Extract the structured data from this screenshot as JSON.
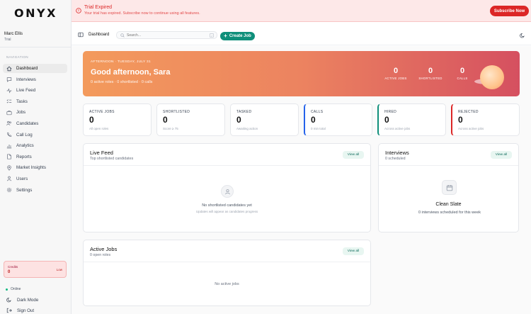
{
  "app": {
    "logo": "ONYX"
  },
  "user": {
    "name": "Marc Ellis",
    "plan": "Trial"
  },
  "sidebar": {
    "heading": "NAVIGATION",
    "items": [
      {
        "label": "Dashboard",
        "icon": "home-icon",
        "active": true
      },
      {
        "label": "Interviews",
        "icon": "chat-icon"
      },
      {
        "label": "Live Feed",
        "icon": "activity-icon"
      },
      {
        "label": "Tasks",
        "icon": "checklist-icon"
      },
      {
        "label": "Jobs",
        "icon": "briefcase-icon"
      },
      {
        "label": "Candidates",
        "icon": "users-icon"
      },
      {
        "label": "Call Log",
        "icon": "phone-icon"
      },
      {
        "label": "Analytics",
        "icon": "chart-icon"
      },
      {
        "label": "Reports",
        "icon": "file-icon"
      },
      {
        "label": "Market Insights",
        "icon": "pin-icon"
      },
      {
        "label": "Users",
        "icon": "user-group-icon"
      },
      {
        "label": "Settings",
        "icon": "gear-icon"
      }
    ],
    "credits": {
      "label": "Credits",
      "value": "0",
      "status": "Low"
    },
    "online": "Online",
    "dark_mode": "Dark Mode",
    "sign_out": "Sign Out"
  },
  "banner": {
    "title": "Trial Expired",
    "message": "Your trial has expired. Subscribe now to continue using all features.",
    "button": "Subscribe Now"
  },
  "topbar": {
    "breadcrumb": "Dashboard",
    "search_placeholder": "Search...",
    "search_shortcut": "/",
    "create_button": "Create Job"
  },
  "hero": {
    "date": "AFTERNOON · TUESDAY, JULY 31",
    "greeting": "Good afternoon, Sara",
    "summary": "0 active roles · 0 shortlisted · 0 calls",
    "stats": [
      {
        "value": "0",
        "label": "ACTIVE JOBS"
      },
      {
        "value": "0",
        "label": "SHORTLISTED"
      },
      {
        "value": "0",
        "label": "CALLS"
      }
    ]
  },
  "stats": [
    {
      "label": "ACTIVE JOBS",
      "value": "0",
      "sub": "All open roles"
    },
    {
      "label": "SHORTLISTED",
      "value": "0",
      "sub": "Score ≥ 75"
    },
    {
      "label": "TASKED",
      "value": "0",
      "sub": "Awaiting action"
    },
    {
      "label": "CALLS",
      "value": "0",
      "sub": "0 min total"
    },
    {
      "label": "HIRED",
      "value": "0",
      "sub": "Across active jobs"
    },
    {
      "label": "REJECTED",
      "value": "0",
      "sub": "Across active jobs"
    }
  ],
  "live_feed": {
    "title": "Live Feed",
    "subtitle": "Top shortlisted candidates",
    "view_all": "View all",
    "empty_title": "No shortlisted candidates yet",
    "empty_sub": "Updates will appear as candidates progress"
  },
  "interviews": {
    "title": "Interviews",
    "subtitle": "0 scheduled",
    "view_all": "View all",
    "empty_title": "Clean Slate",
    "empty_sub": "0 interviews scheduled for this week"
  },
  "active_jobs": {
    "title": "Active Jobs",
    "subtitle": "0 open roles",
    "view_all": "View all",
    "empty_title": "No active jobs"
  }
}
